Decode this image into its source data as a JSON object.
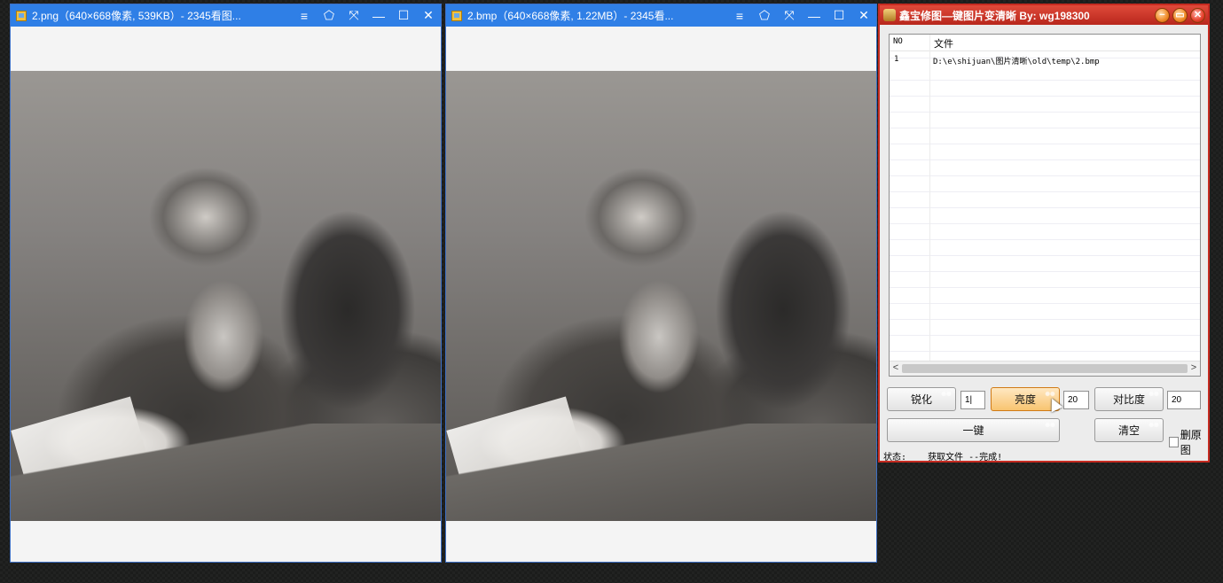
{
  "viewers": [
    {
      "title": "2.png（640×668像素, 539KB）- 2345看图...",
      "controls": [
        "≡",
        "⬠",
        "⤧",
        "—",
        "☐",
        "✕"
      ]
    },
    {
      "title": "2.bmp（640×668像素, 1.22MB）- 2345看...",
      "controls": [
        "≡",
        "⬠",
        "⤧",
        "—",
        "☐",
        "✕"
      ]
    }
  ],
  "tool": {
    "title": "鑫宝修图—键图片变清晰 By: wg198300",
    "window_buttons": [
      "−",
      "▭",
      "✕"
    ],
    "list": {
      "headers": [
        "NO",
        "文件"
      ],
      "rows": [
        {
          "no": "1",
          "path": "D:\\e\\shijuan\\图片清晰\\old\\temp\\2.bmp"
        }
      ],
      "scroll_left": "<",
      "scroll_right": ">"
    },
    "buttons": {
      "sharpen": "锐化",
      "brightness": "亮度",
      "contrast": "对比度",
      "one_click": "一键",
      "clear": "清空"
    },
    "inputs": {
      "sharpen_value": "1|",
      "brightness_value": "20",
      "contrast_value": "20"
    },
    "checkbox_label": "删原图",
    "status_label": "状态:",
    "status_message": "获取文件 --完成!"
  },
  "colors": {
    "viewer_titlebar": "#2f7fe6",
    "tool_titlebar": "#c62b21"
  }
}
